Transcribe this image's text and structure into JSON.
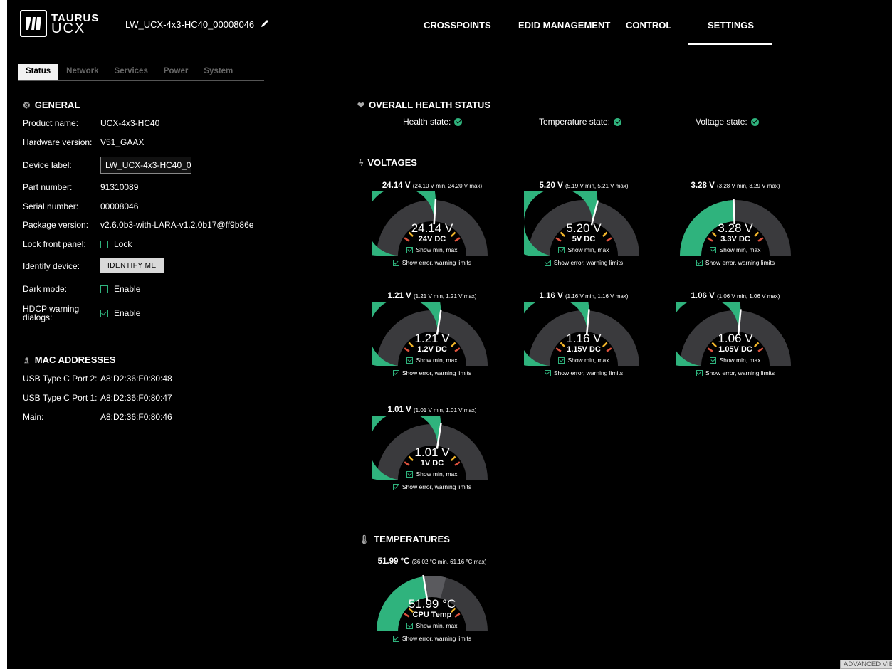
{
  "header": {
    "logo_line1": "TAURUS",
    "logo_line2": "UCX",
    "device_label": "LW_UCX-4x3-HC40_00008046",
    "nav": [
      "CROSSPOINTS",
      "EDID MANAGEMENT",
      "CONTROL",
      "SETTINGS"
    ]
  },
  "subtabs": [
    "Status",
    "Network",
    "Services",
    "Power",
    "System"
  ],
  "general": {
    "title": "GENERAL",
    "product_name_label": "Product name:",
    "product_name": "UCX-4x3-HC40",
    "hw_label": "Hardware version:",
    "hw_value": "V51_GAAX",
    "device_label_label": "Device label:",
    "device_label_value": "LW_UCX-4x3-HC40_0",
    "part_label": "Part number:",
    "part_value": "91310089",
    "serial_label": "Serial number:",
    "serial_value": "00008046",
    "package_label": "Package version:",
    "package_value": "v2.6.0b3-with-LARA-v1.2.0b17@ff9b86e",
    "lock_label": "Lock front panel:",
    "lock_text": "Lock",
    "identify_label": "Identify device:",
    "identify_button": "IDENTIFY ME",
    "dark_label": "Dark mode:",
    "dark_text": "Enable",
    "hdcp_label_1": "HDCP warning",
    "hdcp_label_2": "dialogs:",
    "hdcp_text": "Enable"
  },
  "mac": {
    "title": "MAC ADDRESSES",
    "rows": [
      {
        "label": "USB Type C Port 2:",
        "value": "A8:D2:36:F0:80:48"
      },
      {
        "label": "USB Type C Port 1:",
        "value": "A8:D2:36:F0:80:47"
      },
      {
        "label": "Main:",
        "value": "A8:D2:36:F0:80:46"
      }
    ]
  },
  "health": {
    "title": "OVERALL HEALTH STATUS",
    "items": [
      "Health state:",
      "Temperature state:",
      "Voltage state:"
    ]
  },
  "voltages": {
    "title": "VOLTAGES",
    "gauges": [
      {
        "head": "24.14 V",
        "range": "(24.10 V min, 24.20 V max)",
        "value": "24.14 V",
        "name": "24V DC",
        "fill": 0.52
      },
      {
        "head": "5.20 V",
        "range": "(5.19 V min, 5.21 V max)",
        "value": "5.20 V",
        "name": "5V DC",
        "fill": 0.58
      },
      {
        "head": "3.28 V",
        "range": "(3.28 V min, 3.29 V max)",
        "value": "3.28 V",
        "name": "3.3V DC",
        "fill": 0.49
      },
      {
        "head": "1.21 V",
        "range": "(1.21 V min, 1.21 V max)",
        "value": "1.21 V",
        "name": "1.2V DC",
        "fill": 0.55
      },
      {
        "head": "1.16 V",
        "range": "(1.16 V min, 1.16 V max)",
        "value": "1.16 V",
        "name": "1.15V DC",
        "fill": 0.53
      },
      {
        "head": "1.06 V",
        "range": "(1.06 V min, 1.06 V max)",
        "value": "1.06 V",
        "name": "1.05V DC",
        "fill": 0.53
      },
      {
        "head": "1.01 V",
        "range": "(1.01 V min, 1.01 V max)",
        "value": "1.01 V",
        "name": "1V DC",
        "fill": 0.55
      }
    ]
  },
  "temperatures": {
    "title": "TEMPERATURES",
    "gauges": [
      {
        "head": "51.99 °C",
        "range": "(36.02 °C min, 61.16 °C max)",
        "value": "51.99 °C",
        "name": "CPU Temp",
        "fill": 0.45
      }
    ]
  },
  "gauge_options": {
    "minmax": "Show min, max",
    "limits": "Show error, warning limits"
  },
  "colors": {
    "accent": "#2fb37d",
    "track": "#3a3a3d",
    "warning": "#f0b429",
    "error": "#e0533d"
  },
  "advanced_button": "ADVANCED VIEW"
}
